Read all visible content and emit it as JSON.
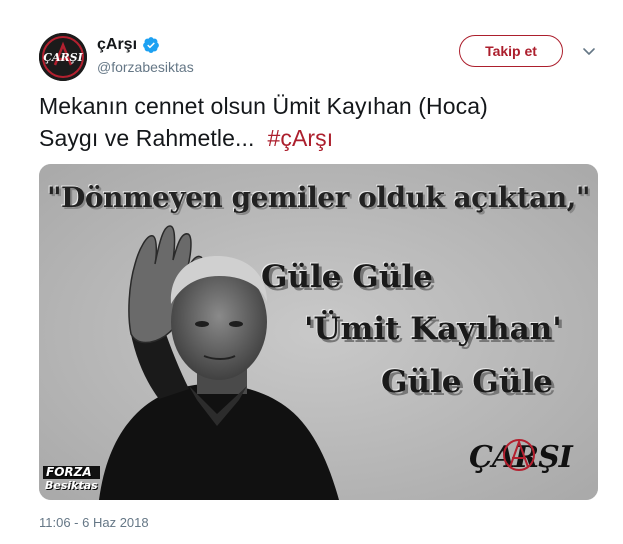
{
  "tweet": {
    "author": {
      "display_name": "çArşı",
      "username": "@forzabesiktas",
      "verified": true,
      "avatar_icon": "carsi-logo-avatar"
    },
    "follow_label": "Takip et",
    "menu_icon": "chevron-down-icon",
    "text_line1": "Mekanın cennet olsun Ümit Kayıhan (Hoca)",
    "text_line2": "Saygı ve Rahmetle...",
    "hashtag": "#çArşı",
    "image": {
      "quote": "\"Dönmeyen gemiler olduk açıktan,\"",
      "line1": "Güle Güle",
      "line2": "'Ümit Kayıhan'",
      "line3": "Güle Güle",
      "forza_line1": "FORZA",
      "forza_line2": "Besiktas",
      "carsi_logo": "ÇARŞI"
    },
    "timestamp": "11:06 - 6 Haz 2018"
  },
  "colors": {
    "accent": "#ac1f2d",
    "text": "#14171a",
    "secondary": "#657786",
    "verified": "#1da1f2"
  }
}
